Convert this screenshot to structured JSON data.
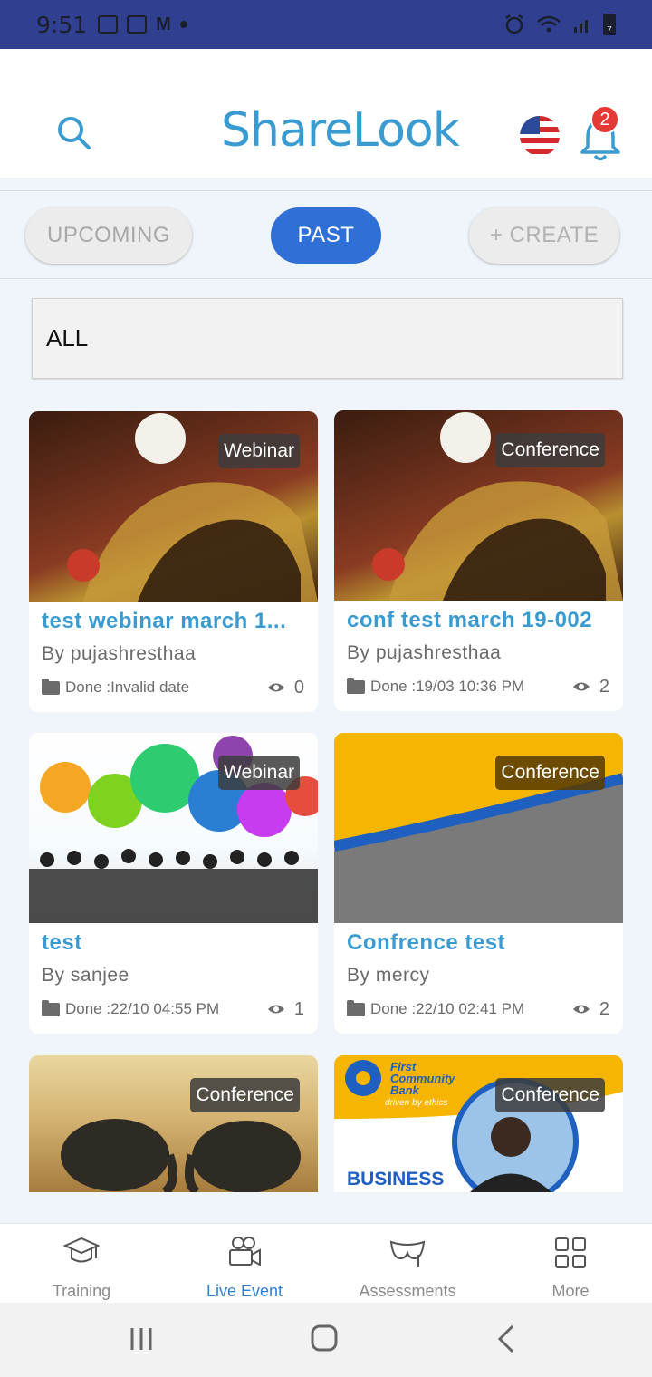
{
  "status_bar": {
    "time": "9:51",
    "battery": "7"
  },
  "header": {
    "logo": "ShareLook",
    "notification_count": "2"
  },
  "tabs": {
    "upcoming": "UPCOMING",
    "past": "PAST",
    "create": "+ CREATE"
  },
  "filter": {
    "value": "ALL"
  },
  "cards": [
    {
      "badge": "Webinar",
      "title": "test webinar march 1...",
      "author": "By pujashresthaa",
      "status": "Done :Invalid date",
      "views": "0"
    },
    {
      "badge": "Conference",
      "title": "conf test march 19-002",
      "author": "By pujashresthaa",
      "status": "Done :19/03 10:36 PM",
      "views": "2"
    },
    {
      "badge": "Webinar",
      "title": "test",
      "author": "By sanjee",
      "status": "Done :22/10 04:55 PM",
      "views": "1"
    },
    {
      "badge": "Conference",
      "title": "Confrence test",
      "author": "By mercy",
      "status": "Done :22/10 02:41 PM",
      "views": "2"
    },
    {
      "badge": "Conference"
    },
    {
      "badge": "Conference",
      "bank_name": "First Community Bank",
      "bank_tagline": "driven by ethics",
      "bank_banner": "BUSINESS"
    }
  ],
  "bottom_nav": {
    "items": [
      {
        "label": "Training",
        "icon": "graduation-cap-icon"
      },
      {
        "label": "Live Event",
        "icon": "video-camera-icon"
      },
      {
        "label": "Assessments",
        "icon": "mask-icon"
      },
      {
        "label": "More",
        "icon": "grid-icon"
      }
    ],
    "active": "Live Event",
    "active_color": "#2f7fd6"
  },
  "colors": {
    "primary": "#2f6fd6",
    "accent_title": "#3a9bd1",
    "status_bar": "#303f8f",
    "badge_red": "#e53935"
  }
}
